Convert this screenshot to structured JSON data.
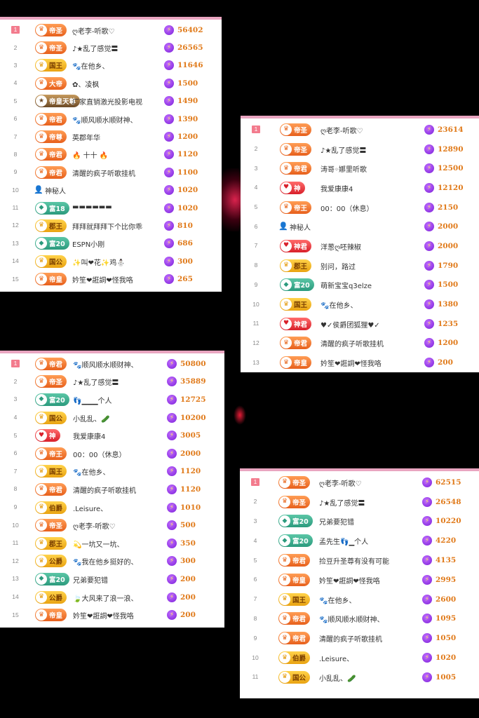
{
  "panels": [
    {
      "rows": [
        {
          "rank": "1",
          "badge": "帝圣",
          "style": "orange",
          "icon": "crown-icon",
          "name": "ღ老李-听歌♡",
          "value": "56402"
        },
        {
          "rank": "2",
          "badge": "帝圣",
          "style": "orange",
          "icon": "crown-icon",
          "name": "♪★乱了感觉〓",
          "value": "26565"
        },
        {
          "rank": "3",
          "badge": "国王",
          "style": "yellow",
          "icon": "crown-icon",
          "name": "🐾在他乡、",
          "value": "11646"
        },
        {
          "rank": "4",
          "badge": "大帝",
          "style": "orange",
          "icon": "crown-icon",
          "name": "✿、凌枫",
          "value": "1500"
        },
        {
          "rank": "5",
          "badge": "帝皇天尊",
          "style": "dark",
          "icon": "star-icon",
          "name": "厂家直销激光投影电视",
          "value": "1490"
        },
        {
          "rank": "6",
          "badge": "帝君",
          "style": "orange",
          "icon": "crown-icon",
          "name": "🐾顺风顺水顺财神、",
          "value": "1390"
        },
        {
          "rank": "7",
          "badge": "帝尊",
          "style": "orange",
          "icon": "crown-icon",
          "name": "英郡年华",
          "value": "1200"
        },
        {
          "rank": "8",
          "badge": "帝君",
          "style": "orange",
          "icon": "crown-icon",
          "name": "🔥 十十 🔥",
          "value": "1120"
        },
        {
          "rank": "9",
          "badge": "帝君",
          "style": "orange",
          "icon": "crown-icon",
          "name": "清醒的疯子听歌挂机",
          "value": "1100"
        },
        {
          "rank": "10",
          "badge": "",
          "style": "mystery",
          "icon": "mystery-person-icon",
          "name": "神秘人",
          "value": "1020"
        },
        {
          "rank": "11",
          "badge": "富18",
          "style": "teal",
          "icon": "diamond-icon",
          "name": "▬▬▬▬▬▬",
          "value": "1020"
        },
        {
          "rank": "12",
          "badge": "郡王",
          "style": "yellow",
          "icon": "crown-icon",
          "name": "拜拜就拜拜下个比你乖",
          "value": "810"
        },
        {
          "rank": "13",
          "badge": "富20",
          "style": "teal",
          "icon": "diamond-icon",
          "name": "ESPN小刚",
          "value": "686"
        },
        {
          "rank": "14",
          "badge": "国公",
          "style": "yellow",
          "icon": "crown-icon",
          "name": "✨叫❤花✨鸡⛄",
          "value": "300"
        },
        {
          "rank": "15",
          "badge": "帝皇",
          "style": "orange",
          "icon": "crown-icon",
          "name": "妗笙❤誑詷❤怪我咯",
          "value": "265"
        }
      ]
    },
    {
      "rows": [
        {
          "rank": "1",
          "badge": "帝圣",
          "style": "orange",
          "icon": "crown-icon",
          "name": "ღ老李-听歌♡",
          "value": "23614"
        },
        {
          "rank": "2",
          "badge": "帝圣",
          "style": "orange",
          "icon": "crown-icon",
          "name": "♪★乱了感觉〓",
          "value": "12890"
        },
        {
          "rank": "3",
          "badge": "帝君",
          "style": "orange",
          "icon": "crown-icon",
          "name": "涛哥◦娜里听歌",
          "value": "12500"
        },
        {
          "rank": "4",
          "badge": "神",
          "style": "red",
          "icon": "heart-icon",
          "name": "我爱康康4",
          "value": "12120"
        },
        {
          "rank": "5",
          "badge": "帝王",
          "style": "orange",
          "icon": "crown-icon",
          "name": "00：00（休息）",
          "value": "2150"
        },
        {
          "rank": "6",
          "badge": "",
          "style": "mystery",
          "icon": "mystery-person-icon",
          "name": "神秘人",
          "value": "2000"
        },
        {
          "rank": "7",
          "badge": "神君",
          "style": "red",
          "icon": "heart-icon",
          "name": "洋葱ღ呸辣椒",
          "value": "2000"
        },
        {
          "rank": "8",
          "badge": "郡王",
          "style": "yellow",
          "icon": "crown-icon",
          "name": "别问，路过",
          "value": "1790"
        },
        {
          "rank": "9",
          "badge": "富20",
          "style": "teal",
          "icon": "diamond-icon",
          "name": "萌新宝宝q3elze",
          "value": "1500"
        },
        {
          "rank": "10",
          "badge": "国王",
          "style": "yellow",
          "icon": "crown-icon",
          "name": "🐾在他乡、",
          "value": "1380"
        },
        {
          "rank": "11",
          "badge": "神君",
          "style": "red",
          "icon": "heart-icon",
          "name": "♥✓侯爵团狐狸♥✓",
          "value": "1235"
        },
        {
          "rank": "12",
          "badge": "帝君",
          "style": "orange",
          "icon": "crown-icon",
          "name": "清醒的疯子听歌挂机",
          "value": "1200"
        },
        {
          "rank": "13",
          "badge": "帝皇",
          "style": "orange",
          "icon": "crown-icon",
          "name": "妗笙❤誑詷❤怪我咯",
          "value": "200"
        }
      ]
    },
    {
      "rows": [
        {
          "rank": "1",
          "badge": "帝君",
          "style": "orange",
          "icon": "crown-icon",
          "name": "🐾顺风顺水顺财神、",
          "value": "50800"
        },
        {
          "rank": "2",
          "badge": "帝圣",
          "style": "orange",
          "icon": "crown-icon",
          "name": "♪★乱了感觉〓",
          "value": "35889"
        },
        {
          "rank": "3",
          "badge": "富20",
          "style": "teal",
          "icon": "diamond-icon",
          "name": "👣▁▁▁个人",
          "value": "12725"
        },
        {
          "rank": "4",
          "badge": "国公",
          "style": "yellow",
          "icon": "crown-icon",
          "name": "小乱乱、🥒",
          "value": "10200"
        },
        {
          "rank": "5",
          "badge": "神",
          "style": "red",
          "icon": "heart-icon",
          "name": "我爱康康4",
          "value": "3005"
        },
        {
          "rank": "6",
          "badge": "帝王",
          "style": "orange",
          "icon": "crown-icon",
          "name": "00：00（休息）",
          "value": "2000"
        },
        {
          "rank": "7",
          "badge": "国王",
          "style": "yellow",
          "icon": "crown-icon",
          "name": "🐾在他乡、",
          "value": "1120"
        },
        {
          "rank": "8",
          "badge": "帝君",
          "style": "orange",
          "icon": "crown-icon",
          "name": "清醒的疯子听歌挂机",
          "value": "1120"
        },
        {
          "rank": "9",
          "badge": "伯爵",
          "style": "yellow",
          "icon": "crown-icon",
          "name": ".Leisure、",
          "value": "1010"
        },
        {
          "rank": "10",
          "badge": "帝圣",
          "style": "orange",
          "icon": "crown-icon",
          "name": "ღ老李-听歌♡",
          "value": "500"
        },
        {
          "rank": "11",
          "badge": "郡王",
          "style": "yellow",
          "icon": "crown-icon",
          "name": "💫一坑又一坑、",
          "value": "350"
        },
        {
          "rank": "12",
          "badge": "公爵",
          "style": "yellow",
          "icon": "crown-icon",
          "name": "🐾我在他乡挺好的、",
          "value": "300"
        },
        {
          "rank": "13",
          "badge": "富20",
          "style": "teal",
          "icon": "diamond-icon",
          "name": "兄弟要犯错",
          "value": "200"
        },
        {
          "rank": "14",
          "badge": "公爵",
          "style": "yellow",
          "icon": "crown-icon",
          "name": "🍃大风来了浪一浪、",
          "value": "200"
        },
        {
          "rank": "15",
          "badge": "帝皇",
          "style": "orange",
          "icon": "crown-icon",
          "name": "妗笙❤誑詷❤怪我咯",
          "value": "200"
        }
      ]
    },
    {
      "rows": [
        {
          "rank": "1",
          "badge": "帝圣",
          "style": "orange",
          "icon": "crown-icon",
          "name": "ღ老李-听歌♡",
          "value": "62515"
        },
        {
          "rank": "2",
          "badge": "帝圣",
          "style": "orange",
          "icon": "crown-icon",
          "name": "♪★乱了感觉〓",
          "value": "26548"
        },
        {
          "rank": "3",
          "badge": "富20",
          "style": "teal",
          "icon": "diamond-icon",
          "name": "兄弟要犯错",
          "value": "10220"
        },
        {
          "rank": "4",
          "badge": "富20",
          "style": "teal",
          "icon": "diamond-icon",
          "name": "孟先生👣▁个人",
          "value": "4220"
        },
        {
          "rank": "5",
          "badge": "帝君",
          "style": "orange",
          "icon": "crown-icon",
          "name": "捡豆升圣尊有没有可能",
          "value": "4135"
        },
        {
          "rank": "6",
          "badge": "帝皇",
          "style": "orange",
          "icon": "crown-icon",
          "name": "妗笙❤誑詷❤怪我咯",
          "value": "2995"
        },
        {
          "rank": "7",
          "badge": "国王",
          "style": "yellow",
          "icon": "crown-icon",
          "name": "🐾在他乡、",
          "value": "2600"
        },
        {
          "rank": "8",
          "badge": "帝君",
          "style": "orange",
          "icon": "crown-icon",
          "name": "🐾顺风顺水顺财神、",
          "value": "1095"
        },
        {
          "rank": "9",
          "badge": "帝君",
          "style": "orange",
          "icon": "crown-icon",
          "name": "清醒的疯子听歌挂机",
          "value": "1050"
        },
        {
          "rank": "10",
          "badge": "伯爵",
          "style": "yellow",
          "icon": "crown-icon",
          "name": ".Leisure、",
          "value": "1020"
        },
        {
          "rank": "11",
          "badge": "国公",
          "style": "yellow",
          "icon": "crown-icon",
          "name": "小乱乱、🥒",
          "value": "1005"
        }
      ]
    }
  ]
}
